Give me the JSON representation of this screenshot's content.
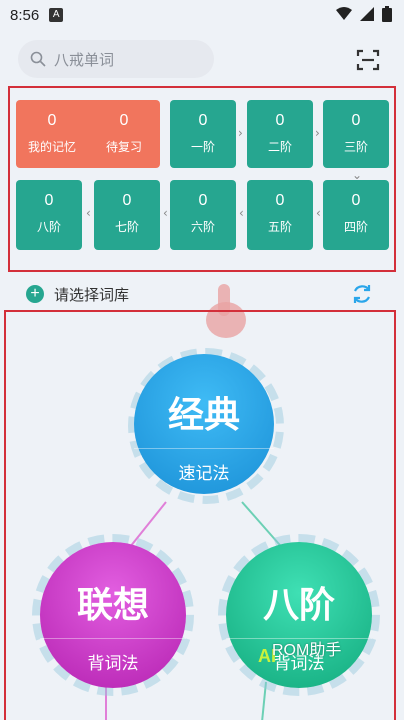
{
  "status_bar": {
    "time": "8:56",
    "notification_badge": "A"
  },
  "search": {
    "placeholder": "八戒单词"
  },
  "stats": {
    "my_memory": {
      "value": "0",
      "label": "我的记忆"
    },
    "to_review": {
      "value": "0",
      "label": "待复习"
    },
    "stages": [
      {
        "value": "0",
        "label": "一阶"
      },
      {
        "value": "0",
        "label": "二阶"
      },
      {
        "value": "0",
        "label": "三阶"
      },
      {
        "value": "0",
        "label": "四阶"
      },
      {
        "value": "0",
        "label": "五阶"
      },
      {
        "value": "0",
        "label": "六阶"
      },
      {
        "value": "0",
        "label": "七阶"
      },
      {
        "value": "0",
        "label": "八阶"
      }
    ]
  },
  "wordbook": {
    "select_label": "请选择词库"
  },
  "modes": {
    "classic": {
      "title": "经典",
      "sub": "速记法"
    },
    "association": {
      "title": "联想",
      "sub": "背词法"
    },
    "eight_stage": {
      "title": "八阶",
      "sub": "背词法",
      "badge": "AI"
    }
  },
  "watermark": "ROM助手",
  "colors": {
    "teal": "#26a690",
    "orange": "#f1755d",
    "classic_blue": "#2aa6ea",
    "association_purple": "#d037c8",
    "eight_stage_green": "#27c79a",
    "frame_red": "#d32f3a"
  }
}
